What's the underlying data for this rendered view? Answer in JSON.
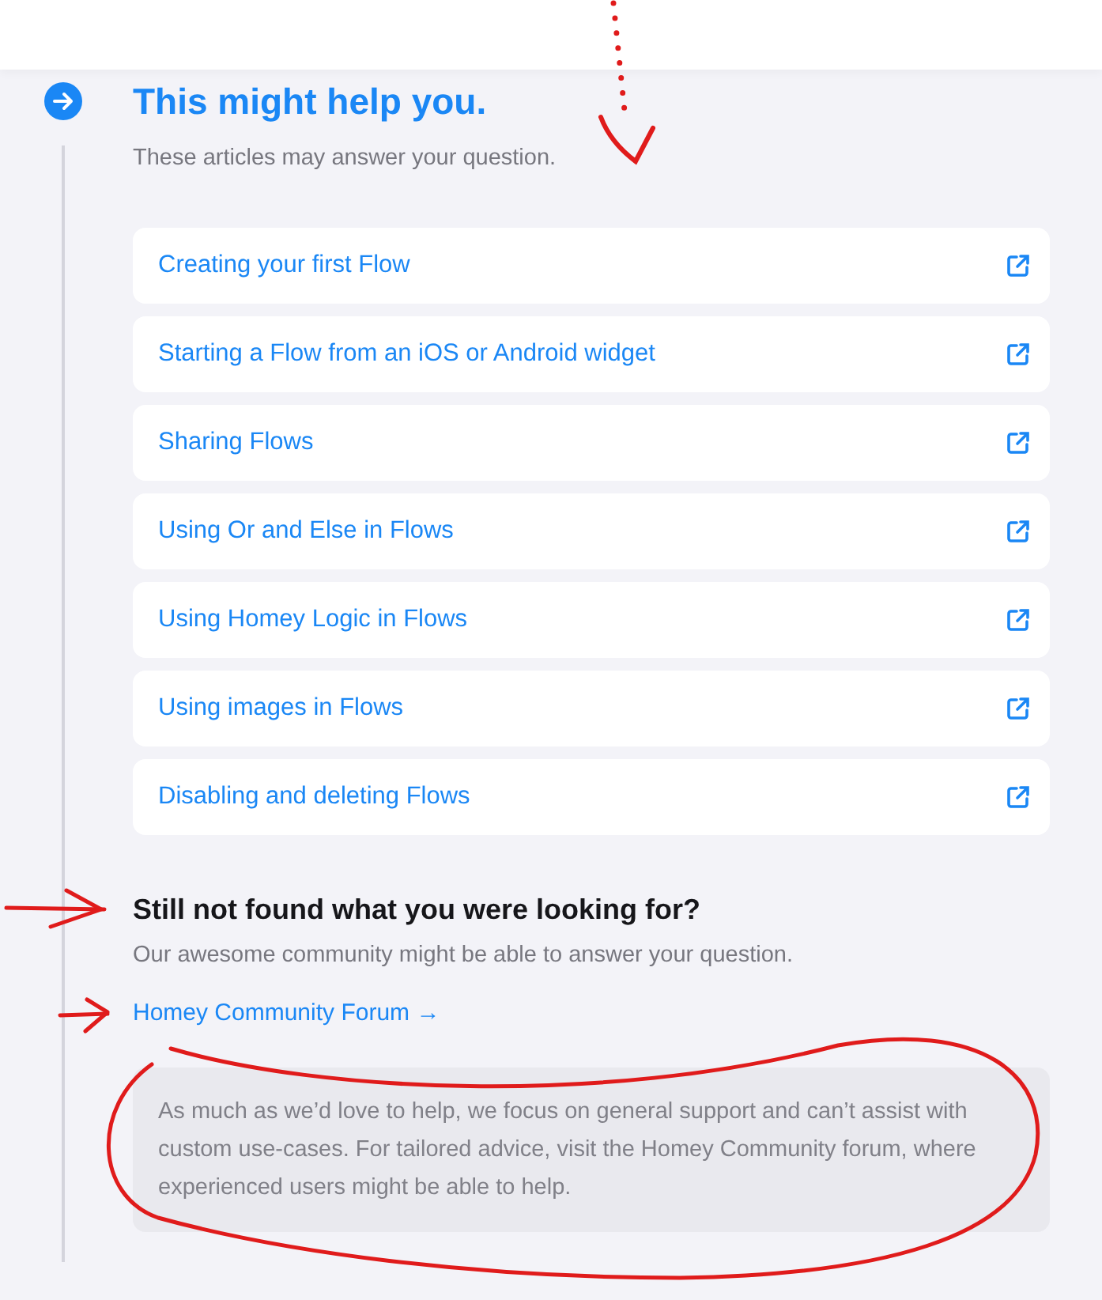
{
  "section": {
    "title": "This might help you.",
    "subtitle": "These articles may answer your question."
  },
  "articles": [
    {
      "title": "Creating your first Flow"
    },
    {
      "title": "Starting a Flow from an iOS or Android widget"
    },
    {
      "title": "Sharing Flows"
    },
    {
      "title": "Using Or and Else in Flows"
    },
    {
      "title": "Using Homey Logic in Flows"
    },
    {
      "title": "Using images in Flows"
    },
    {
      "title": "Disabling and deleting Flows"
    }
  ],
  "community": {
    "title": "Still not found what you were looking for?",
    "subtitle": "Our awesome community might be able to answer your question.",
    "link": "Homey Community Forum",
    "link_arrow": "→",
    "note": "As much as we’d love to help, we focus on general support and can’t assist with custom use-cases. For tailored advice, visit the Homey Community forum, where experienced users might be able to help."
  }
}
